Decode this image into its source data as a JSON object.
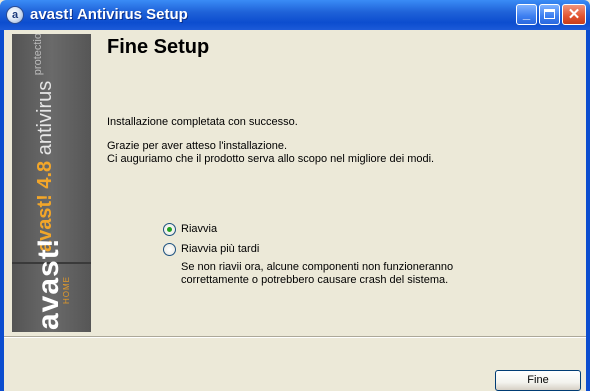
{
  "window": {
    "title": "avast! Antivirus Setup",
    "icon_glyph": "a",
    "minimize_glyph": "_",
    "close_glyph": "✕"
  },
  "banner": {
    "brand": "avast!",
    "version": "4.8",
    "product": "antivirus",
    "tagline": "protection",
    "logo": "avast!",
    "edition": "HOME"
  },
  "page": {
    "title": "Fine Setup",
    "line1": "Installazione completata con successo.",
    "line2": "Grazie per aver atteso l'installazione.",
    "line3": "Ci auguriamo che il prodotto serva allo scopo nel migliore dei modi."
  },
  "options": {
    "restart_now": "Riavvia",
    "restart_later": "Riavvia più tardi",
    "selected": "restart_now",
    "note_line1": "Se non riavii ora, alcune componenti non funzioneranno",
    "note_line2": "correttamente o potrebbero causare crash del sistema."
  },
  "buttons": {
    "finish": "Fine"
  },
  "colors": {
    "titlebar": "#0c4dcf",
    "dialog_bg": "#ece9d8",
    "banner_bg": "#5f5f5f",
    "banner_accent": "#f2a62a",
    "close_button": "#e2532f",
    "radio_dot": "#21a121"
  }
}
